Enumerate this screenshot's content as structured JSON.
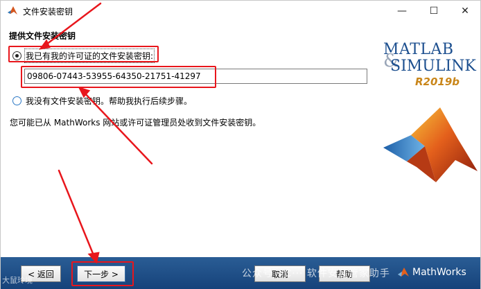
{
  "window": {
    "title": "文件安装密钥",
    "minimize_glyph": "—",
    "maximize_glyph": "☐",
    "close_glyph": "✕"
  },
  "main": {
    "section_title": "提供文件安装密钥",
    "option_have_key": "我已有我的许可证的文件安装密钥:",
    "key_value": "09806-07443-53955-64350-21751-41297",
    "option_no_key": "我没有文件安装密钥。帮助我执行后续步骤。",
    "info_text": "您可能已从 MathWorks 网站或许可证管理员处收到文件安装密钥。"
  },
  "logo": {
    "matlab": "MATLAB",
    "amp": "&",
    "simulink": "SIMULINK",
    "release": "R2019b"
  },
  "footer": {
    "back_label": "< 返回",
    "next_label": "下一步 >",
    "cancel_label": "取消",
    "help_label": "帮助",
    "mathworks_label": "MathWorks",
    "watermark_right": "公众号 · C··· 软件安装管家助手",
    "watermark_left": "大鼠玲境"
  },
  "colors": {
    "annotation_red": "#e8161c",
    "footer_blue": "#1f4f88",
    "brand_blue": "#1c4f8f",
    "release_orange": "#c9861a"
  },
  "icons": [
    "matlab-icon",
    "minimize-icon",
    "maximize-icon",
    "close-icon",
    "mathworks-logo-icon"
  ]
}
